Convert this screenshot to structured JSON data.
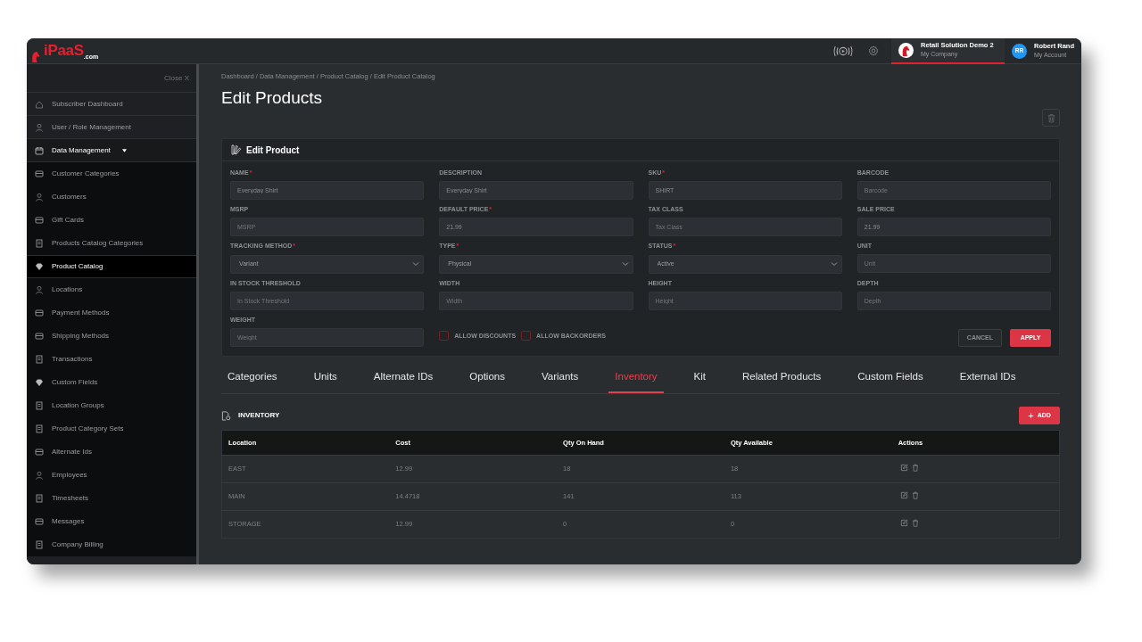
{
  "header": {
    "logo": {
      "main": "iPaaS",
      "suffix": ".com"
    },
    "company": {
      "name": "Retail Solution Demo 2",
      "subtitle": "My Company",
      "selected": true
    },
    "account": {
      "initials": "RR",
      "name": "Robert Rand",
      "subtitle": "My Account"
    }
  },
  "sidebar": {
    "close_label": "Close X",
    "items": [
      {
        "label": "Subscriber Dashboard",
        "selected": false
      },
      {
        "label": "User / Role Management",
        "selected": false
      },
      {
        "label": "Data Management",
        "selected": false,
        "expanded": true,
        "children": [
          {
            "label": "Customer Categories",
            "selected": false
          },
          {
            "label": "Customers",
            "selected": false
          },
          {
            "label": "Gift Cards",
            "selected": false
          },
          {
            "label": "Products Catalog Categories",
            "selected": false
          },
          {
            "label": "Product Catalog",
            "selected": true
          },
          {
            "label": "Locations",
            "selected": false
          },
          {
            "label": "Payment Methods",
            "selected": false
          },
          {
            "label": "Shipping Methods",
            "selected": false
          },
          {
            "label": "Transactions",
            "selected": false
          },
          {
            "label": "Custom Fields",
            "selected": false
          },
          {
            "label": "Location Groups",
            "selected": false
          },
          {
            "label": "Product Category Sets",
            "selected": false
          },
          {
            "label": "Alternate Ids",
            "selected": false
          },
          {
            "label": "Employees",
            "selected": false
          },
          {
            "label": "Timesheets",
            "selected": false
          },
          {
            "label": "Messages",
            "selected": false
          },
          {
            "label": "Company Billing",
            "selected": false
          }
        ]
      }
    ]
  },
  "breadcrumb": "Dashboard / Data Management / Product Catalog / Edit Product Catalog",
  "page_title": "Edit Products",
  "form": {
    "title": "Edit Product",
    "fields": [
      {
        "label": "NAME",
        "required_mark": "*",
        "kind": "text",
        "value": "Everyday Shirt"
      },
      {
        "label": "DESCRIPTION",
        "kind": "text",
        "value": "Everyday Shirt"
      },
      {
        "label": "SKU",
        "required_mark": "*",
        "kind": "text",
        "value": "SHIRT"
      },
      {
        "label": "BARCODE",
        "kind": "text",
        "placeholder": "Barcode"
      },
      {
        "label": "MSRP",
        "kind": "text",
        "placeholder": "MSRP"
      },
      {
        "label": "DEFAULT PRICE",
        "required_mark": "*",
        "kind": "text",
        "value": "21.99"
      },
      {
        "label": "TAX CLASS",
        "kind": "text",
        "placeholder": "Tax Class"
      },
      {
        "label": "SALE PRICE",
        "kind": "text",
        "value": "21.99"
      },
      {
        "label": "TRACKING METHOD",
        "required_mark": "*",
        "kind": "select",
        "value": "Variant"
      },
      {
        "label": "TYPE",
        "required_mark": "*",
        "kind": "select",
        "value": "Physical"
      },
      {
        "label": "STATUS",
        "required_mark": "*",
        "kind": "select",
        "value": "Active"
      },
      {
        "label": "UNIT",
        "kind": "text",
        "placeholder": "Unit"
      },
      {
        "label": "IN STOCK THRESHOLD",
        "kind": "text",
        "placeholder": "In Stock Threshold"
      },
      {
        "label": "WIDTH",
        "kind": "text",
        "placeholder": "Width"
      },
      {
        "label": "HEIGHT",
        "kind": "text",
        "placeholder": "Height"
      },
      {
        "label": "DEPTH",
        "kind": "text",
        "placeholder": "Depth"
      },
      {
        "label": "WEIGHT",
        "kind": "text",
        "placeholder": "Weight"
      }
    ],
    "checkboxes": [
      {
        "label": "ALLOW DISCOUNTS",
        "checked": false
      },
      {
        "label": "ALLOW BACKORDERS",
        "checked": false
      }
    ],
    "buttons": [
      {
        "label": "CANCEL",
        "kind": "secondary"
      },
      {
        "label": "APPLY",
        "kind": "primary"
      }
    ]
  },
  "tabs": [
    {
      "label": "Categories",
      "selected": false
    },
    {
      "label": "Units",
      "selected": false
    },
    {
      "label": "Alternate IDs",
      "selected": false
    },
    {
      "label": "Options",
      "selected": false
    },
    {
      "label": "Variants",
      "selected": false
    },
    {
      "label": "Inventory",
      "selected": true
    },
    {
      "label": "Kit",
      "selected": false
    },
    {
      "label": "Related Products",
      "selected": false
    },
    {
      "label": "Custom Fields",
      "selected": false
    },
    {
      "label": "External IDs",
      "selected": false
    }
  ],
  "inventory": {
    "title": "INVENTORY",
    "add_button": {
      "icon": "+",
      "label": "ADD"
    },
    "columns": [
      "Location",
      "Cost",
      "Qty On Hand",
      "Qty Available",
      "Actions"
    ],
    "rows": [
      {
        "cells": [
          "EAST",
          "12.99",
          "18",
          "18"
        ]
      },
      {
        "cells": [
          "MAIN",
          "14.4718",
          "141",
          "113"
        ]
      },
      {
        "cells": [
          "STORAGE",
          "12.99",
          "0",
          "0"
        ]
      }
    ]
  }
}
